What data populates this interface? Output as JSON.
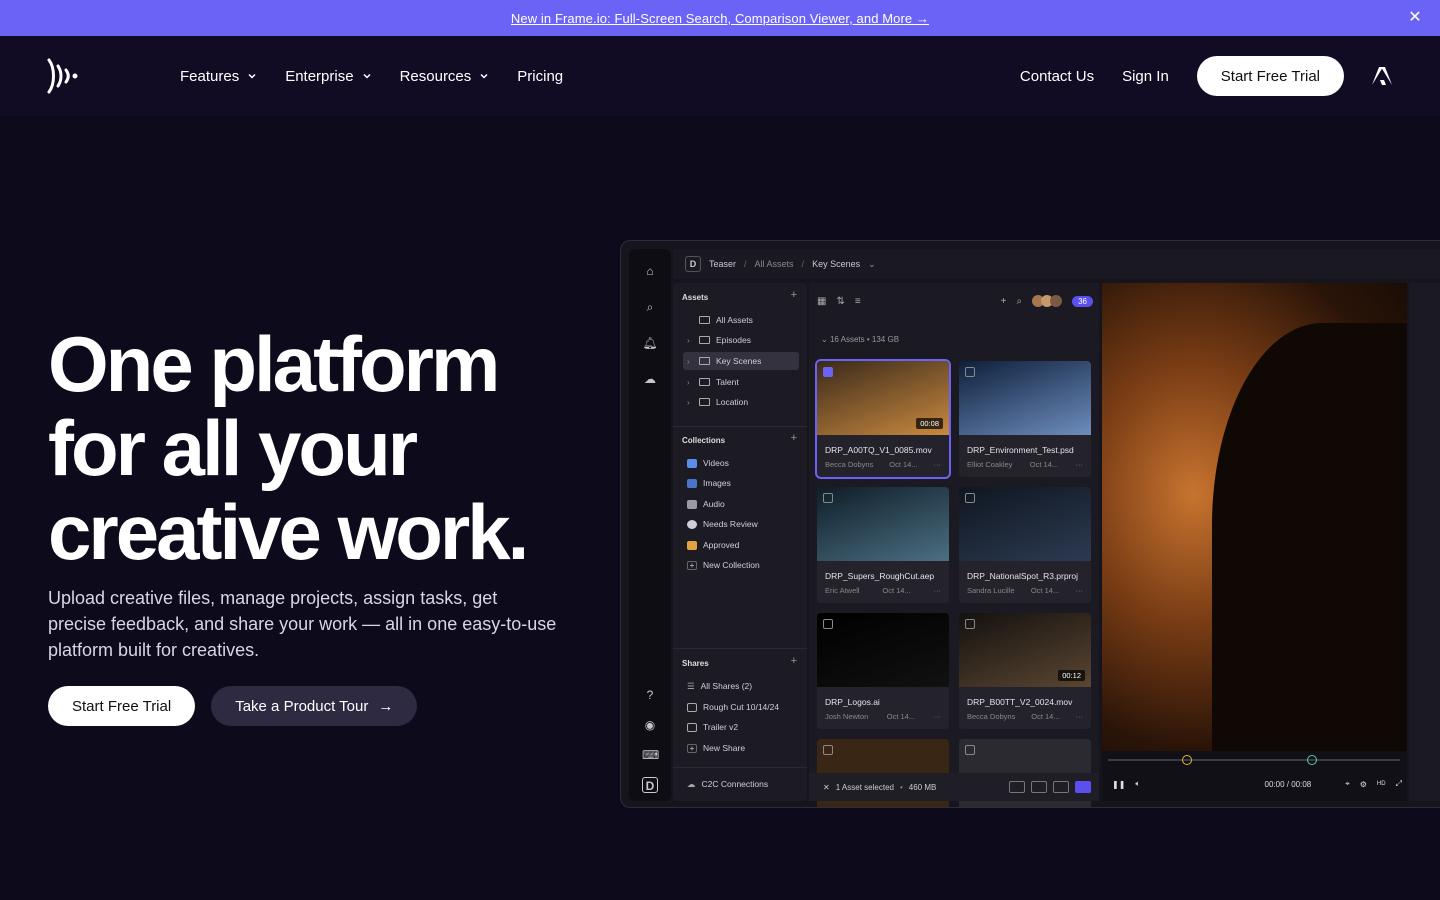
{
  "announcement": {
    "text": "New in Frame.io: Full-Screen Search, Comparison Viewer, and More →",
    "close_icon": "close-icon"
  },
  "nav": {
    "logo_icon": "frameio-logo-icon",
    "items": [
      {
        "label": "Features",
        "has_dropdown": true
      },
      {
        "label": "Enterprise",
        "has_dropdown": true
      },
      {
        "label": "Resources",
        "has_dropdown": true
      },
      {
        "label": "Pricing",
        "has_dropdown": false
      }
    ],
    "contact": "Contact Us",
    "sign_in": "Sign In",
    "cta": "Start Free Trial",
    "adobe_icon": "adobe-logo-icon"
  },
  "hero": {
    "title_lines": [
      "One platform",
      "for all your",
      "creative work."
    ],
    "subtitle": "Upload creative files, manage projects, assign tasks, get precise feedback, and share your work — all in one easy-to-use platform built for creatives.",
    "primary_cta": "Start Free Trial",
    "secondary_cta": "Take a Product Tour",
    "secondary_cta_icon": "→"
  },
  "app": {
    "breadcrumb": {
      "project": "Teaser",
      "level1": "All Assets",
      "level2": "Key Scenes"
    },
    "sidebar": {
      "assets_heading": "Assets",
      "assets": [
        {
          "label": "All Assets"
        },
        {
          "label": "Episodes"
        },
        {
          "label": "Key Scenes",
          "selected": true
        },
        {
          "label": "Talent"
        },
        {
          "label": "Location"
        }
      ],
      "collections_heading": "Collections",
      "collections": [
        {
          "label": "Videos",
          "color": "#5a8ee8"
        },
        {
          "label": "Images",
          "color": "#4a73c9"
        },
        {
          "label": "Audio",
          "color": "#9a9aa6"
        },
        {
          "label": "Needs Review",
          "color": "#cfcfd8"
        },
        {
          "label": "Approved",
          "color": "#e0a341"
        },
        {
          "label": "New Collection",
          "color": "#555"
        }
      ],
      "shares_heading": "Shares",
      "shares": [
        {
          "label": "All Shares (2)"
        },
        {
          "label": "Rough Cut 10/14/24"
        },
        {
          "label": "Trailer v2"
        },
        {
          "label": "New Share"
        }
      ],
      "c2c": "C2C Connections"
    },
    "toolbar": {
      "members_count": "36"
    },
    "asset_count": "16 Assets",
    "asset_size": "134 GB",
    "assets": [
      {
        "name": "DRP_A00TQ_V1_0085.mov",
        "author": "Becca Dobyns",
        "date": "Oct 14...",
        "duration": "00:08",
        "selected": true,
        "color1": "#3a2a1a",
        "color2": "#c9893f"
      },
      {
        "name": "DRP_Environment_Test.psd",
        "author": "Elliot Coakley",
        "date": "Oct 14...",
        "duration": "",
        "selected": false,
        "color1": "#0e1f3a",
        "color2": "#6d8dbd"
      },
      {
        "name": "DRP_Supers_RoughCut.aep",
        "author": "Eric Atwell",
        "date": "Oct 14...",
        "duration": "",
        "selected": false,
        "color1": "#0f1d28",
        "color2": "#4b6f82"
      },
      {
        "name": "DRP_NationalSpot_R3.prproj",
        "author": "Sandra Lucille",
        "date": "Oct 14...",
        "duration": "",
        "selected": false,
        "color1": "#0f1620",
        "color2": "#2c3a52"
      },
      {
        "name": "DRP_Logos.ai",
        "author": "Josh Newton",
        "date": "Oct 14...",
        "duration": "",
        "selected": false,
        "color1": "#000000",
        "color2": "#111111"
      },
      {
        "name": "DRP_B00TT_V2_0024.mov",
        "author": "Becca Dobyns",
        "date": "Oct 14...",
        "duration": "00:12",
        "selected": false,
        "color1": "#14110f",
        "color2": "#5a4632"
      }
    ],
    "selection": {
      "label": "1 Asset selected",
      "size": "460 MB"
    },
    "player": {
      "time": "00:00 / 00:08",
      "quality": "HD"
    }
  }
}
